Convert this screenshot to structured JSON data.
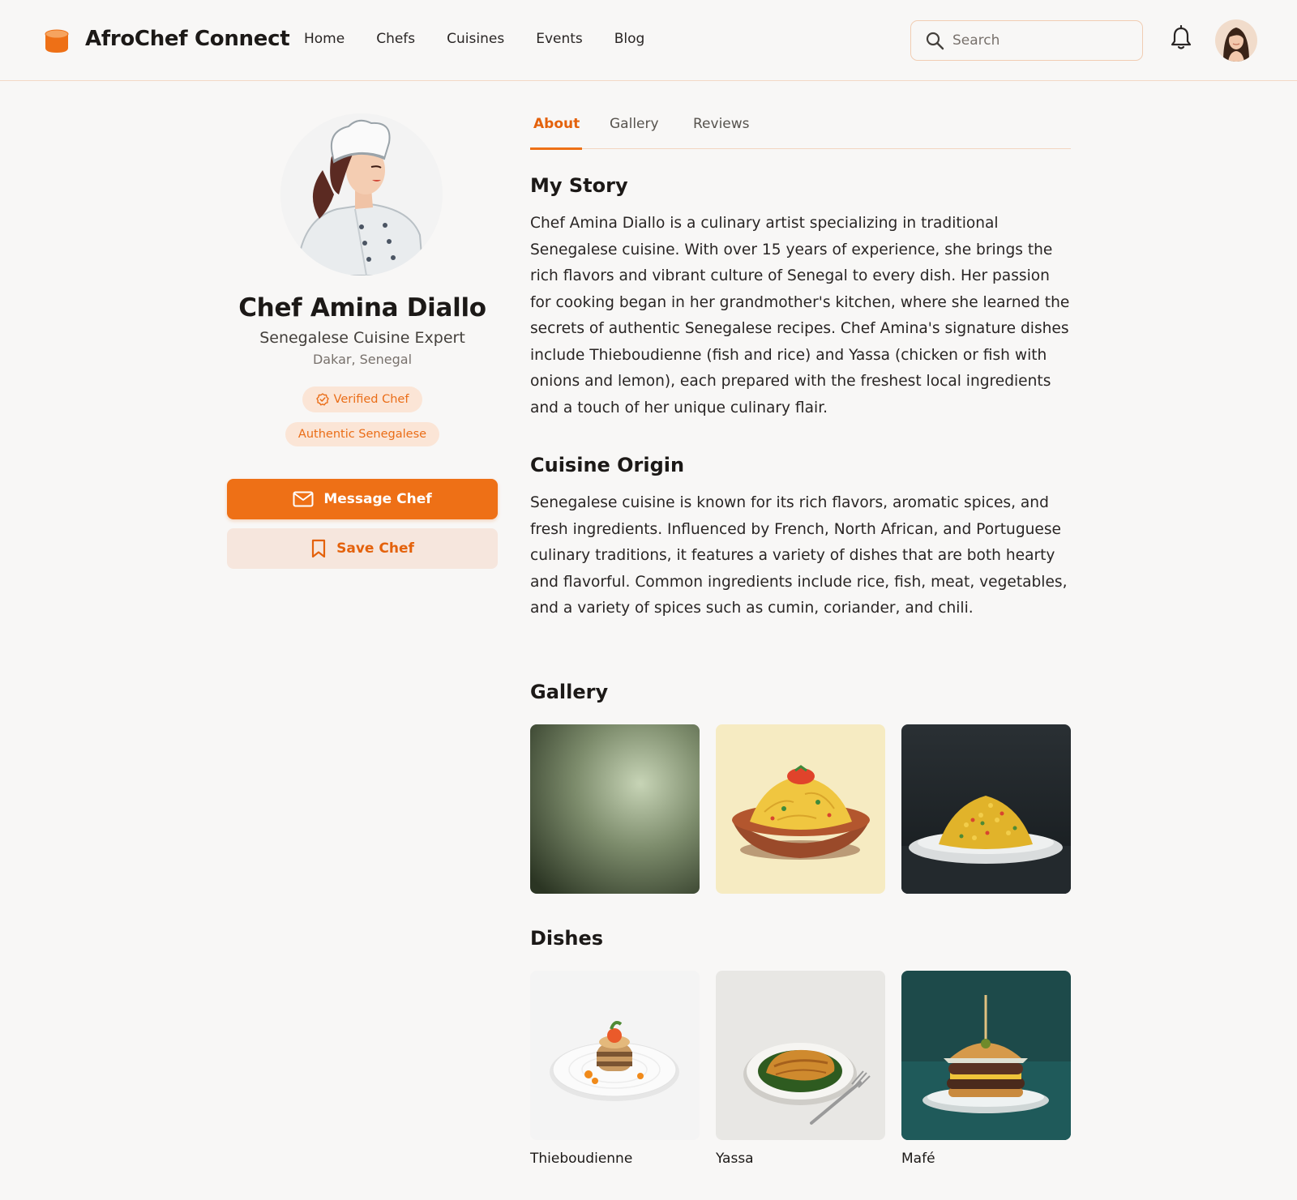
{
  "header": {
    "brand": "AfroChef Connect",
    "nav": [
      "Home",
      "Chefs",
      "Cuisines",
      "Events",
      "Blog"
    ],
    "search_placeholder": "Search"
  },
  "profile": {
    "name": "Chef Amina Diallo",
    "title": "Senegalese Cuisine Expert",
    "location": "Dakar, Senegal",
    "badges": [
      "Verified Chef",
      "Authentic Senegalese"
    ],
    "message_button": "Message Chef",
    "save_button": "Save Chef"
  },
  "tabs": [
    "About",
    "Gallery",
    "Reviews"
  ],
  "about": {
    "story_heading": "My Story",
    "story_text": "Chef Amina Diallo is a culinary artist specializing in traditional Senegalese cuisine. With over 15 years of experience, she brings the rich flavors and vibrant culture of Senegal to every dish. Her passion for cooking began in her grandmother's kitchen, where she learned the secrets of authentic Senegalese recipes. Chef Amina's signature dishes include Thieboudienne (fish and rice) and Yassa (chicken or fish with onions and lemon), each prepared with the freshest local ingredients and a touch of her unique culinary flair.",
    "origin_heading": "Cuisine Origin",
    "origin_text": "Senegalese cuisine is known for its rich flavors, aromatic spices, and fresh ingredients. Influenced by French, North African, and Portuguese culinary traditions, it features a variety of dishes that are both hearty and flavorful. Common ingredients include rice, fish, meat, vegetables, and a variety of spices such as cumin, coriander, and chili.",
    "gallery_heading": "Gallery",
    "dishes_heading": "Dishes",
    "dishes": [
      "Thieboudienne",
      "Yassa",
      "Mafé"
    ]
  },
  "colors": {
    "accent": "#ee7016",
    "accent_soft": "#fbe5d6",
    "background": "#f8f7f6"
  }
}
